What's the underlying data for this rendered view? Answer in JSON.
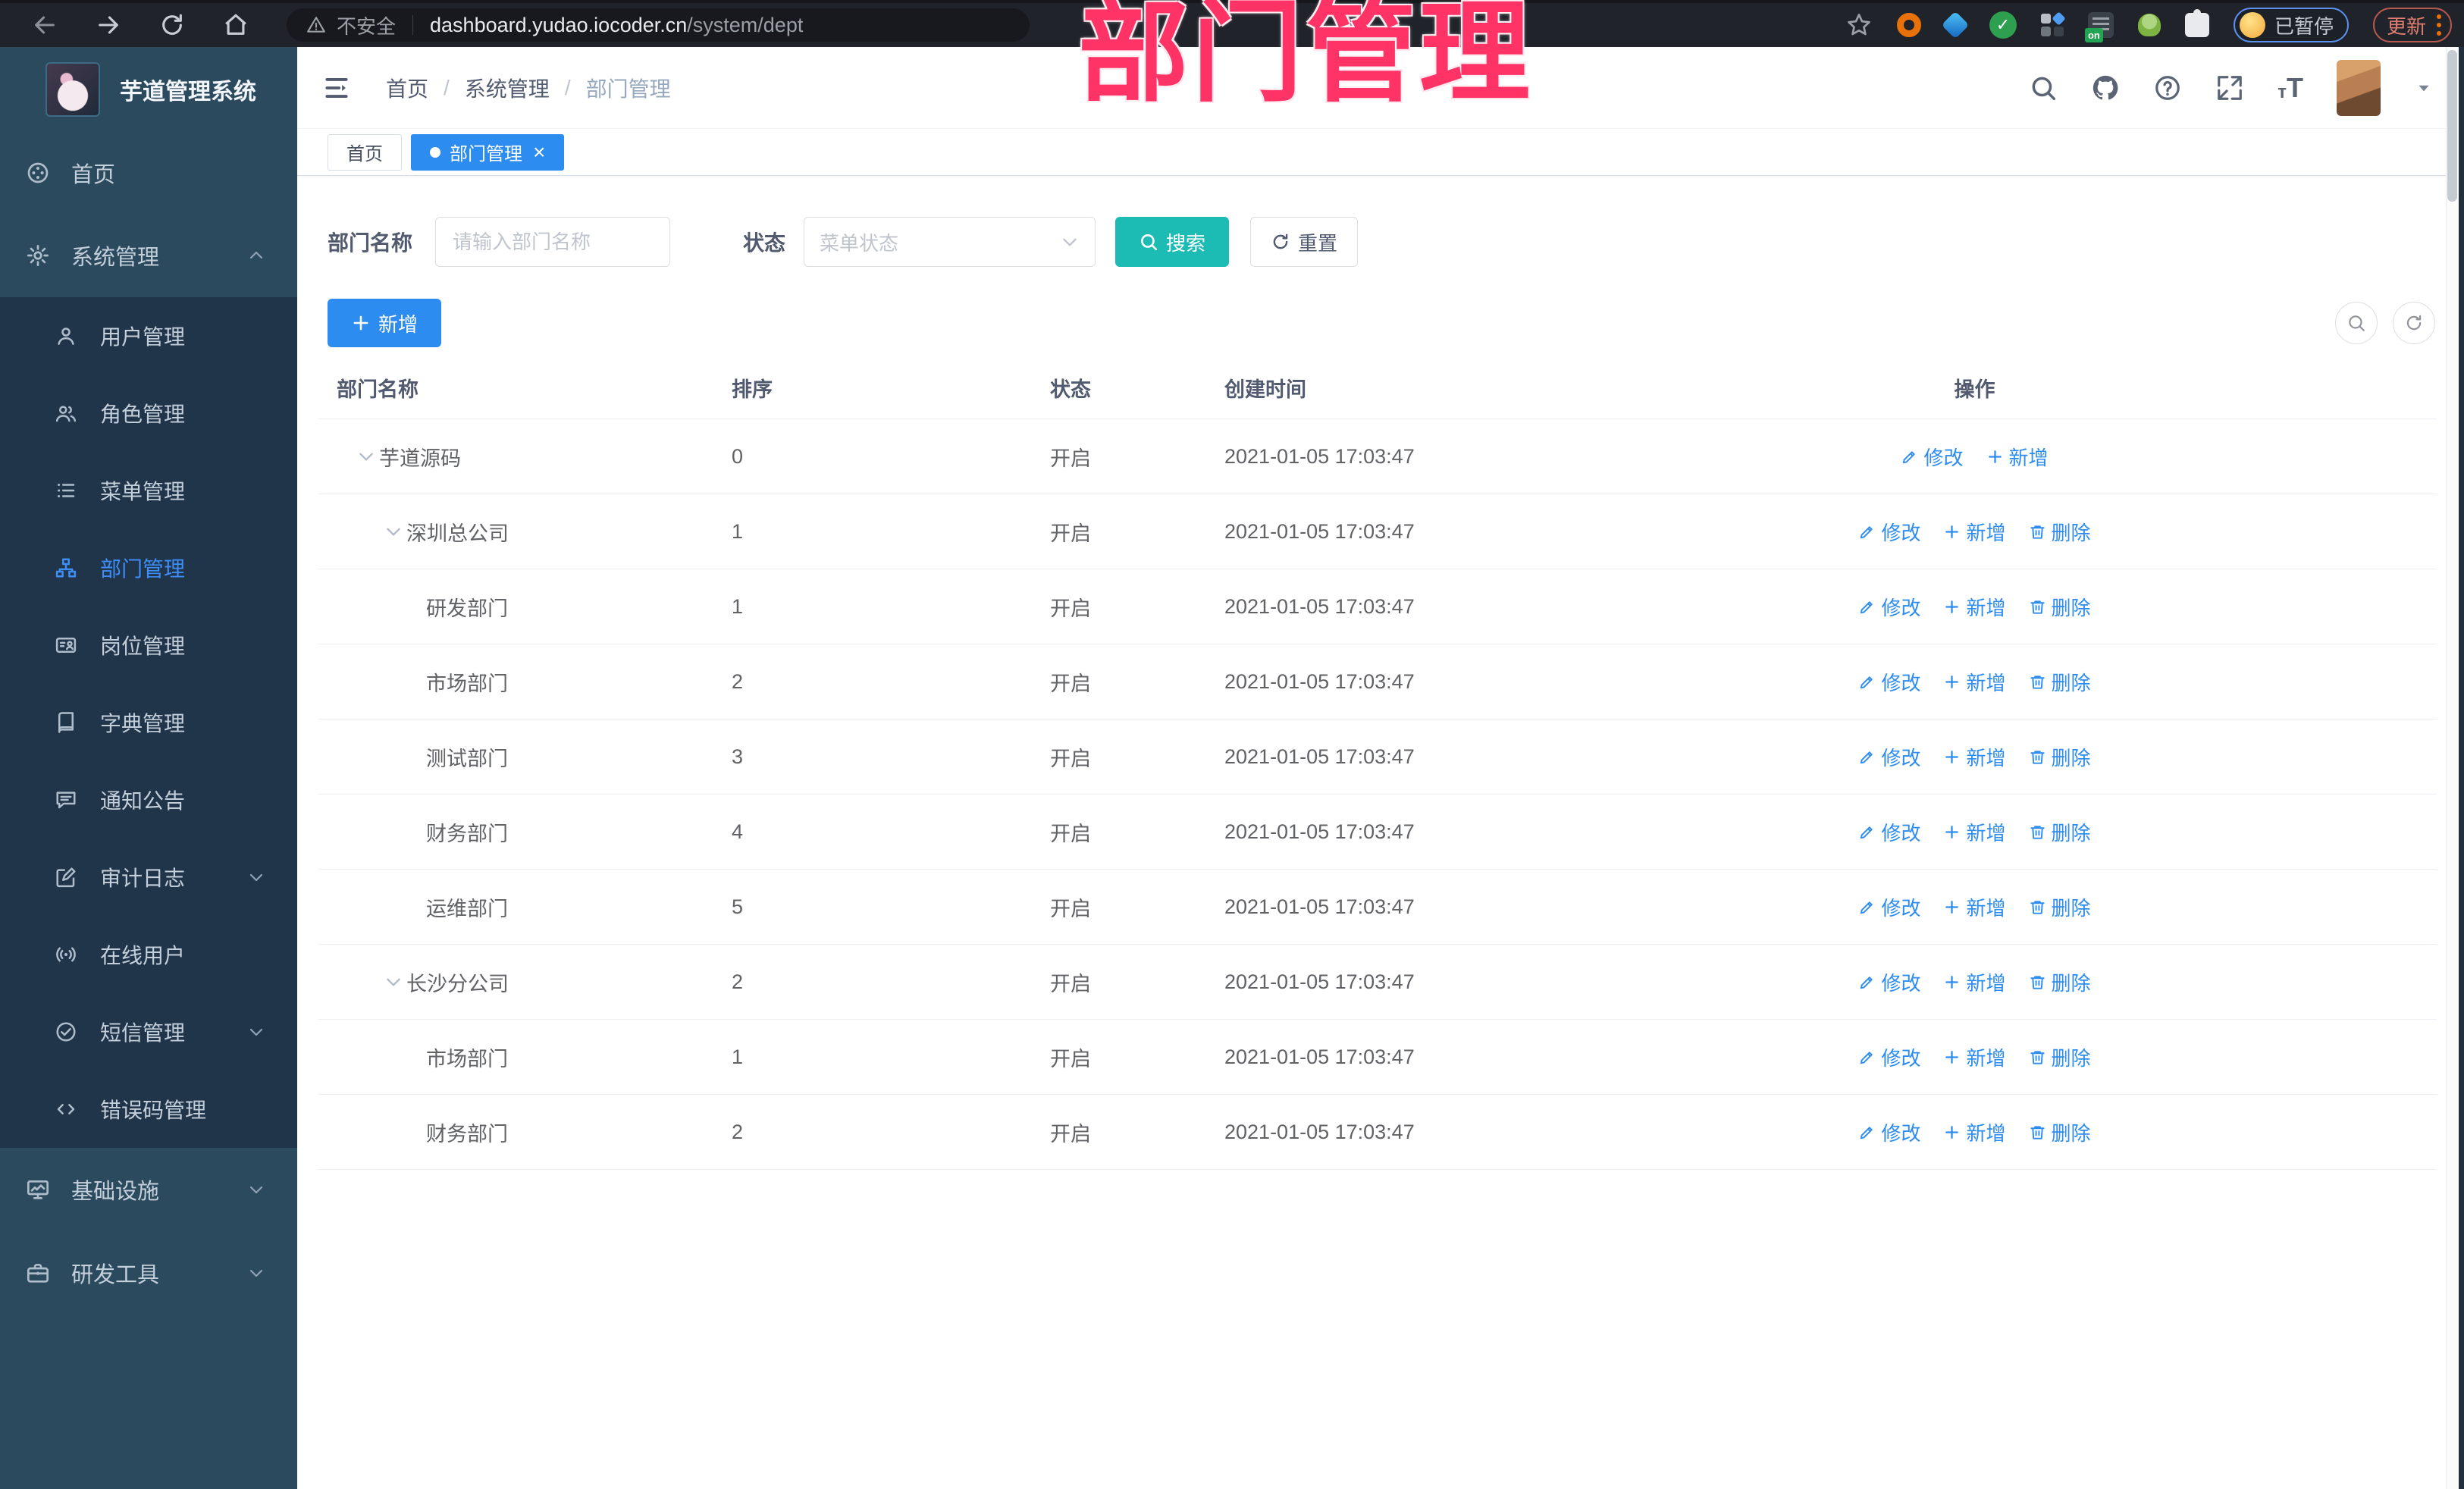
{
  "browser": {
    "security_label": "不安全",
    "url_domain": "dashboard.yudao.iocoder.cn",
    "url_path": "/system/dept",
    "paused_badge": "已暂停",
    "update_label": "更新"
  },
  "watermark": "部门管理",
  "colors": {
    "accent_blue": "#2d8cf0",
    "teal_button": "#1cbbb4",
    "watermark_pink": "#ff3366",
    "sidebar_bg": "#2c4a5e",
    "submenu_bg": "#20344a",
    "active_menu": "#3e8ef7"
  },
  "sidebar": {
    "title": "芋道管理系统",
    "items": [
      {
        "id": "home",
        "label": "首页",
        "icon": "dashboard-icon"
      },
      {
        "id": "system",
        "label": "系统管理",
        "icon": "system-gear-icon",
        "expanded": true,
        "children": [
          {
            "id": "user",
            "label": "用户管理",
            "icon": "user-icon"
          },
          {
            "id": "role",
            "label": "角色管理",
            "icon": "roles-icon"
          },
          {
            "id": "menu",
            "label": "菜单管理",
            "icon": "menu-list-icon"
          },
          {
            "id": "dept",
            "label": "部门管理",
            "icon": "org-tree-icon",
            "active": true
          },
          {
            "id": "post",
            "label": "岗位管理",
            "icon": "id-card-icon"
          },
          {
            "id": "dict",
            "label": "字典管理",
            "icon": "book-icon"
          },
          {
            "id": "notice",
            "label": "通知公告",
            "icon": "bubble-icon"
          },
          {
            "id": "audit",
            "label": "审计日志",
            "icon": "audit-icon",
            "chevron": "down"
          },
          {
            "id": "online",
            "label": "在线用户",
            "icon": "online-icon"
          },
          {
            "id": "sms",
            "label": "短信管理",
            "icon": "check-circle-icon",
            "chevron": "down"
          },
          {
            "id": "errorcode",
            "label": "错误码管理",
            "icon": "code-icon"
          }
        ]
      },
      {
        "id": "infra",
        "label": "基础设施",
        "icon": "monitor-icon",
        "chevron": "down"
      },
      {
        "id": "tools",
        "label": "研发工具",
        "icon": "toolbox-icon",
        "chevron": "down"
      }
    ]
  },
  "header": {
    "breadcrumb": [
      "首页",
      "系统管理",
      "部门管理"
    ]
  },
  "tabs": [
    {
      "label": "首页",
      "active": false
    },
    {
      "label": "部门管理",
      "active": true,
      "closable": true
    }
  ],
  "filters": {
    "name_label": "部门名称",
    "name_placeholder": "请输入部门名称",
    "status_label": "状态",
    "status_placeholder": "菜单状态",
    "search_label": "搜索",
    "reset_label": "重置"
  },
  "toolbar": {
    "add_label": "新增"
  },
  "table": {
    "columns": [
      "部门名称",
      "排序",
      "状态",
      "创建时间",
      "操作"
    ],
    "action_labels": {
      "edit": "修改",
      "add": "新增",
      "delete": "删除"
    },
    "rows": [
      {
        "name": "芋道源码",
        "level": 0,
        "expandable": true,
        "sort": "0",
        "status": "开启",
        "created": "2021-01-05 17:03:47",
        "actions": [
          "edit",
          "add"
        ]
      },
      {
        "name": "深圳总公司",
        "level": 1,
        "expandable": true,
        "sort": "1",
        "status": "开启",
        "created": "2021-01-05 17:03:47",
        "actions": [
          "edit",
          "add",
          "delete"
        ]
      },
      {
        "name": "研发部门",
        "level": 2,
        "expandable": false,
        "sort": "1",
        "status": "开启",
        "created": "2021-01-05 17:03:47",
        "actions": [
          "edit",
          "add",
          "delete"
        ]
      },
      {
        "name": "市场部门",
        "level": 2,
        "expandable": false,
        "sort": "2",
        "status": "开启",
        "created": "2021-01-05 17:03:47",
        "actions": [
          "edit",
          "add",
          "delete"
        ]
      },
      {
        "name": "测试部门",
        "level": 2,
        "expandable": false,
        "sort": "3",
        "status": "开启",
        "created": "2021-01-05 17:03:47",
        "actions": [
          "edit",
          "add",
          "delete"
        ]
      },
      {
        "name": "财务部门",
        "level": 2,
        "expandable": false,
        "sort": "4",
        "status": "开启",
        "created": "2021-01-05 17:03:47",
        "actions": [
          "edit",
          "add",
          "delete"
        ]
      },
      {
        "name": "运维部门",
        "level": 2,
        "expandable": false,
        "sort": "5",
        "status": "开启",
        "created": "2021-01-05 17:03:47",
        "actions": [
          "edit",
          "add",
          "delete"
        ]
      },
      {
        "name": "长沙分公司",
        "level": 1,
        "expandable": true,
        "sort": "2",
        "status": "开启",
        "created": "2021-01-05 17:03:47",
        "actions": [
          "edit",
          "add",
          "delete"
        ]
      },
      {
        "name": "市场部门",
        "level": 2,
        "expandable": false,
        "sort": "1",
        "status": "开启",
        "created": "2021-01-05 17:03:47",
        "actions": [
          "edit",
          "add",
          "delete"
        ]
      },
      {
        "name": "财务部门",
        "level": 2,
        "expandable": false,
        "sort": "2",
        "status": "开启",
        "created": "2021-01-05 17:03:47",
        "actions": [
          "edit",
          "add",
          "delete"
        ]
      }
    ]
  }
}
